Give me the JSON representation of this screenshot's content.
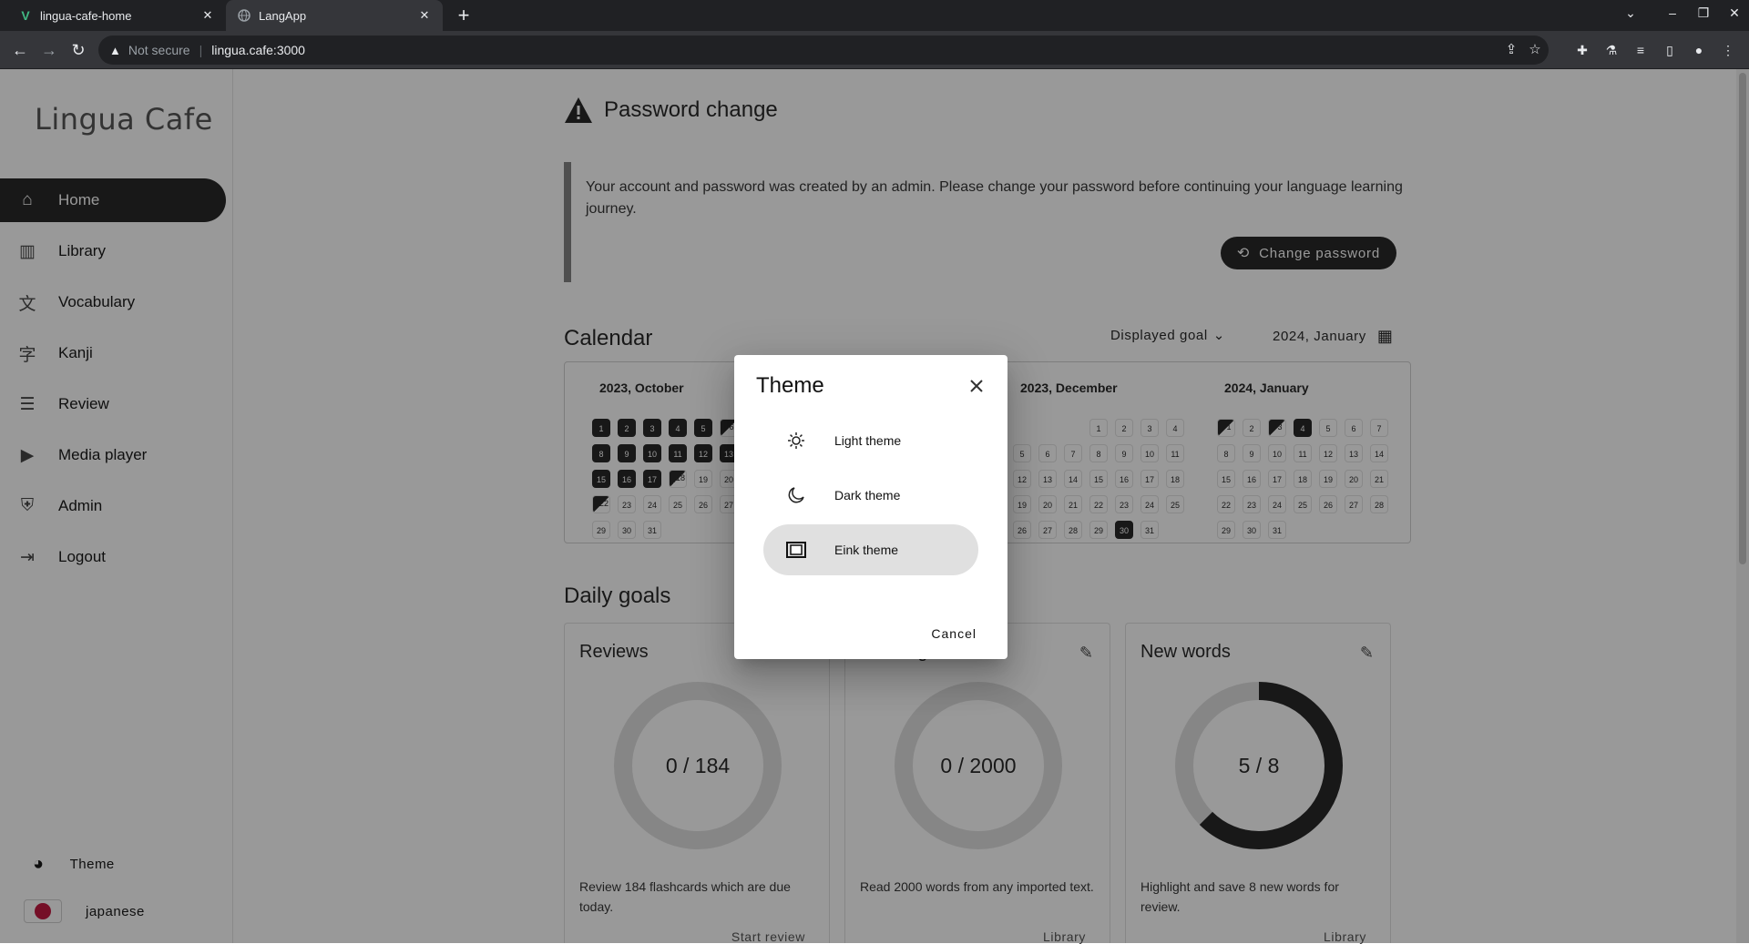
{
  "browser": {
    "tabs": [
      {
        "title": "lingua-cafe-home",
        "favicon": "vue-logo-icon"
      },
      {
        "title": "LangApp",
        "favicon": "globe-icon"
      }
    ],
    "security": "Not secure",
    "url": "lingua.cafe:3000"
  },
  "app": {
    "logo": "Lingua Cafe",
    "nav": [
      {
        "label": "Home",
        "icon": "home-icon",
        "active": true
      },
      {
        "label": "Library",
        "icon": "books-icon"
      },
      {
        "label": "Vocabulary",
        "icon": "translate-icon"
      },
      {
        "label": "Kanji",
        "icon": "kanji-icon"
      },
      {
        "label": "Review",
        "icon": "review-list-icon"
      },
      {
        "label": "Media player",
        "icon": "movie-icon"
      },
      {
        "label": "Admin",
        "icon": "shield-icon"
      },
      {
        "label": "Logout",
        "icon": "logout-icon"
      }
    ],
    "theme_label": "Theme",
    "language_label": "japanese"
  },
  "password_change": {
    "title": "Password change",
    "message": "Your account and password was created by an admin. Please change your password before continuing your language learning journey.",
    "button": "Change password"
  },
  "calendar": {
    "title": "Calendar",
    "goal_select": "Displayed goal",
    "date_select": "2024, January",
    "months": [
      {
        "title": "2023, October"
      },
      {
        "title": "2023, December"
      },
      {
        "title": "2024, January"
      }
    ]
  },
  "daily_goals": {
    "title": "Daily goals",
    "cards": [
      {
        "title": "Reviews",
        "progress": "0 / 184",
        "description": "Review 184 flashcards which are due today.",
        "link": "Start review",
        "fraction": 0
      },
      {
        "title": "Reading",
        "progress": "0 / 2000",
        "description": "Read 2000 words from any imported text.",
        "link": "Library",
        "fraction": 0
      },
      {
        "title": "New words",
        "progress": "5 / 8",
        "description": "Highlight and save 8 new words for review.",
        "link": "Library",
        "fraction": 0.625
      }
    ]
  },
  "theme_dialog": {
    "title": "Theme",
    "options": [
      {
        "label": "Light theme",
        "icon": "light-theme-icon"
      },
      {
        "label": "Dark theme",
        "icon": "dark-theme-icon"
      },
      {
        "label": "Eink theme",
        "icon": "eink-theme-icon",
        "selected": true
      }
    ],
    "cancel": "Cancel"
  }
}
